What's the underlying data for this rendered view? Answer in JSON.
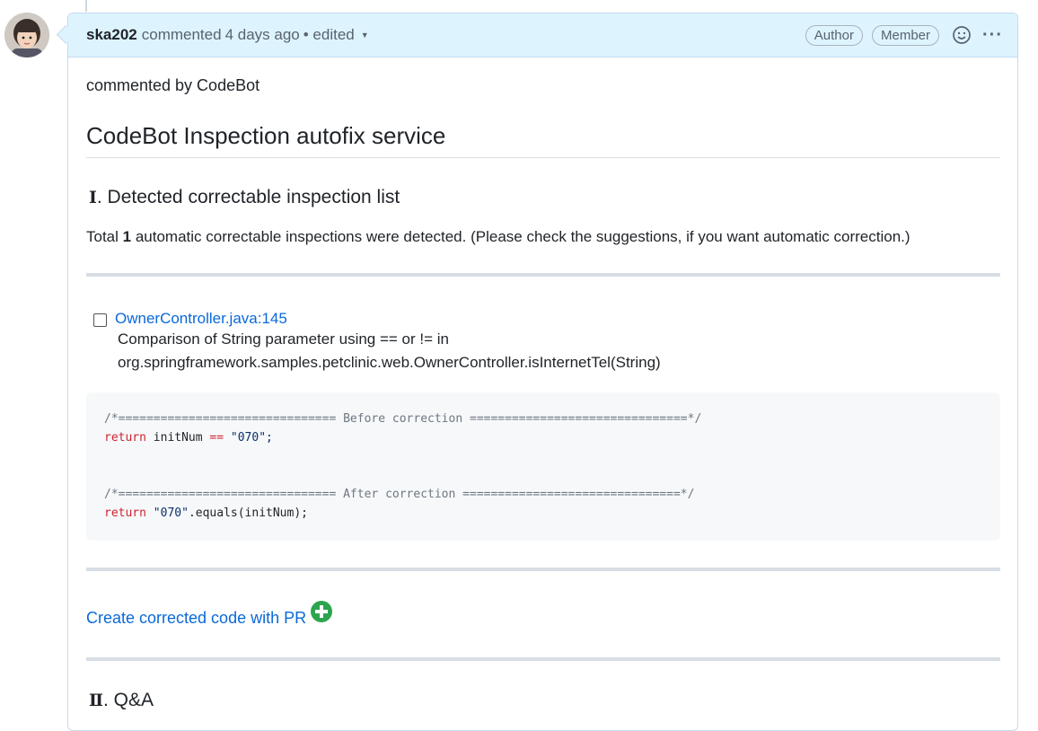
{
  "comment": {
    "author": "ska202",
    "action": "commented",
    "time": "4 days ago",
    "edited": "• edited",
    "badges": [
      "Author",
      "Member"
    ],
    "icons": {
      "react": "smiley-icon",
      "more": "kebab-icon"
    }
  },
  "body": {
    "commented_by": "commented by CodeBot",
    "title": "CodeBot Inspection autofix service",
    "section1": {
      "roman": "Ⅰ",
      "title": ". Detected correctable inspection list"
    },
    "total": {
      "prefix": "Total ",
      "count": "1",
      "suffix": " automatic correctable inspections were detected. (Please check the suggestions, if you want automatic correction.)"
    },
    "task": {
      "file": "OwnerController.java:145",
      "desc_line1": "Comparison of String parameter using == or != in",
      "desc_line2": "org.springframework.samples.petclinic.web.OwnerController.isInternetTel(String)"
    },
    "code": {
      "before_comment": "/*=============================== Before correction ===============================*/",
      "before_kw": "return",
      "before_mid": " initNum ",
      "before_op": "==",
      "before_str": " \"070\";",
      "after_comment": "/*=============================== After correction ===============================*/",
      "after_kw": "return",
      "after_str": " \"070\"",
      "after_rest": ".equals(initNum);"
    },
    "cta": "Create corrected code with PR",
    "section2": {
      "roman": "Ⅱ",
      "title": ". Q&A"
    }
  },
  "colors": {
    "link": "#0969da",
    "header_bg": "#ddf4ff",
    "plus_icon": "#2da44e",
    "keyword": "#cf222e"
  }
}
